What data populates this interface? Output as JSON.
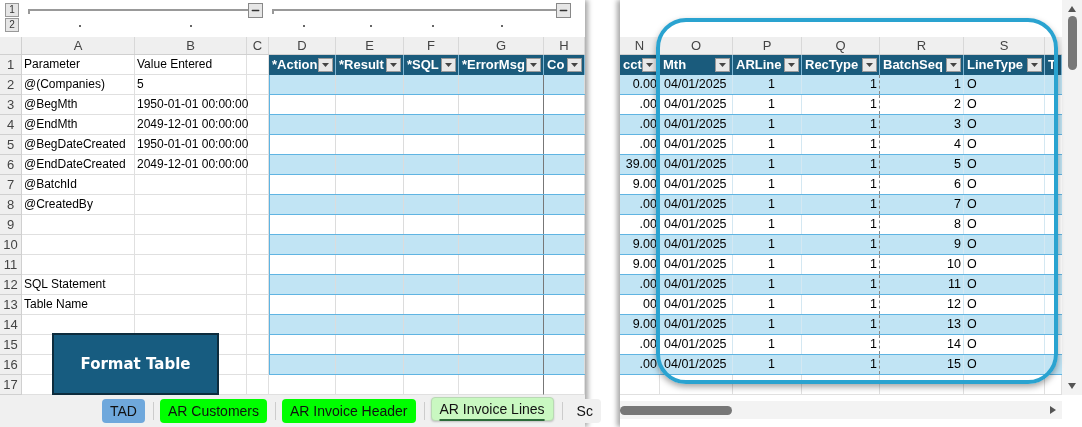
{
  "outline": {
    "levels": [
      "1",
      "2"
    ]
  },
  "left_sheet": {
    "columns": [
      "A",
      "B",
      "C",
      "D",
      "E",
      "F",
      "G",
      "H"
    ],
    "rows": [
      {
        "number": "1",
        "parameter": "Parameter",
        "value": "Value Entered"
      },
      {
        "number": "2",
        "parameter": "@(Companies)",
        "value": "5"
      },
      {
        "number": "3",
        "parameter": "@BegMth",
        "value": "1950-01-01 00:00:00"
      },
      {
        "number": "4",
        "parameter": "@EndMth",
        "value": "2049-12-01 00:00:00"
      },
      {
        "number": "5",
        "parameter": "@BegDateCreated",
        "value": "1950-01-01 00:00:00"
      },
      {
        "number": "6",
        "parameter": "@EndDateCreated",
        "value": "2049-12-01 00:00:00"
      },
      {
        "number": "7",
        "parameter": "@BatchId"
      },
      {
        "number": "8",
        "parameter": "@CreatedBy"
      },
      {
        "number": "9"
      },
      {
        "number": "10"
      },
      {
        "number": "11"
      },
      {
        "number": "12",
        "parameter": "SQL Statement"
      },
      {
        "number": "13",
        "parameter": "Table Name"
      },
      {
        "number": "14"
      },
      {
        "number": "15"
      },
      {
        "number": "16"
      },
      {
        "number": "17"
      }
    ],
    "table_headers": [
      "*Action",
      "*Result",
      "*SQL",
      "*ErrorMsg",
      "Co"
    ]
  },
  "format_button": {
    "label": "Format Table"
  },
  "right_sheet": {
    "columns": [
      "N",
      "O",
      "P",
      "Q",
      "R",
      "S"
    ],
    "table_headers": [
      "cct",
      "Mth",
      "ARLine",
      "RecType",
      "BatchSeq",
      "LineType",
      "T"
    ],
    "rows": [
      [
        "0.00",
        "04/01/2025",
        "1",
        "1",
        "1",
        "O"
      ],
      [
        ".00",
        "04/01/2025",
        "1",
        "1",
        "2",
        "O"
      ],
      [
        ".00",
        "04/01/2025",
        "1",
        "1",
        "3",
        "O"
      ],
      [
        ".00",
        "04/01/2025",
        "1",
        "1",
        "4",
        "O"
      ],
      [
        "39.00",
        "04/01/2025",
        "1",
        "1",
        "5",
        "O"
      ],
      [
        "9.00",
        "04/01/2025",
        "1",
        "1",
        "6",
        "O"
      ],
      [
        ".00",
        "04/01/2025",
        "1",
        "1",
        "7",
        "O"
      ],
      [
        ".00",
        "04/01/2025",
        "1",
        "1",
        "8",
        "O"
      ],
      [
        "9.00",
        "04/01/2025",
        "1",
        "1",
        "9",
        "O"
      ],
      [
        "9.00",
        "04/01/2025",
        "1",
        "1",
        "10",
        "O"
      ],
      [
        ".00",
        "04/01/2025",
        "1",
        "1",
        "11",
        "O"
      ],
      [
        "00",
        "04/01/2025",
        "1",
        "1",
        "12",
        "O"
      ],
      [
        "9.00",
        "04/01/2025",
        "1",
        "1",
        "13",
        "O"
      ],
      [
        ".00",
        "04/01/2025",
        "1",
        "1",
        "14",
        "O"
      ],
      [
        ".00",
        "04/01/2025",
        "1",
        "1",
        "15",
        "O"
      ]
    ]
  },
  "sheet_tabs": [
    {
      "label": "TAD",
      "selected": false,
      "color": "#6fa8dc"
    },
    {
      "label": "AR Customers",
      "selected": false,
      "color": "#00ff00"
    },
    {
      "label": "AR Invoice Header",
      "selected": false,
      "color": "#00ff00"
    },
    {
      "label": "AR Invoice Lines",
      "selected": true,
      "color": "#c9f8c1"
    },
    {
      "label": "Sc",
      "selected": false,
      "color": "#f0f0f0"
    }
  ]
}
